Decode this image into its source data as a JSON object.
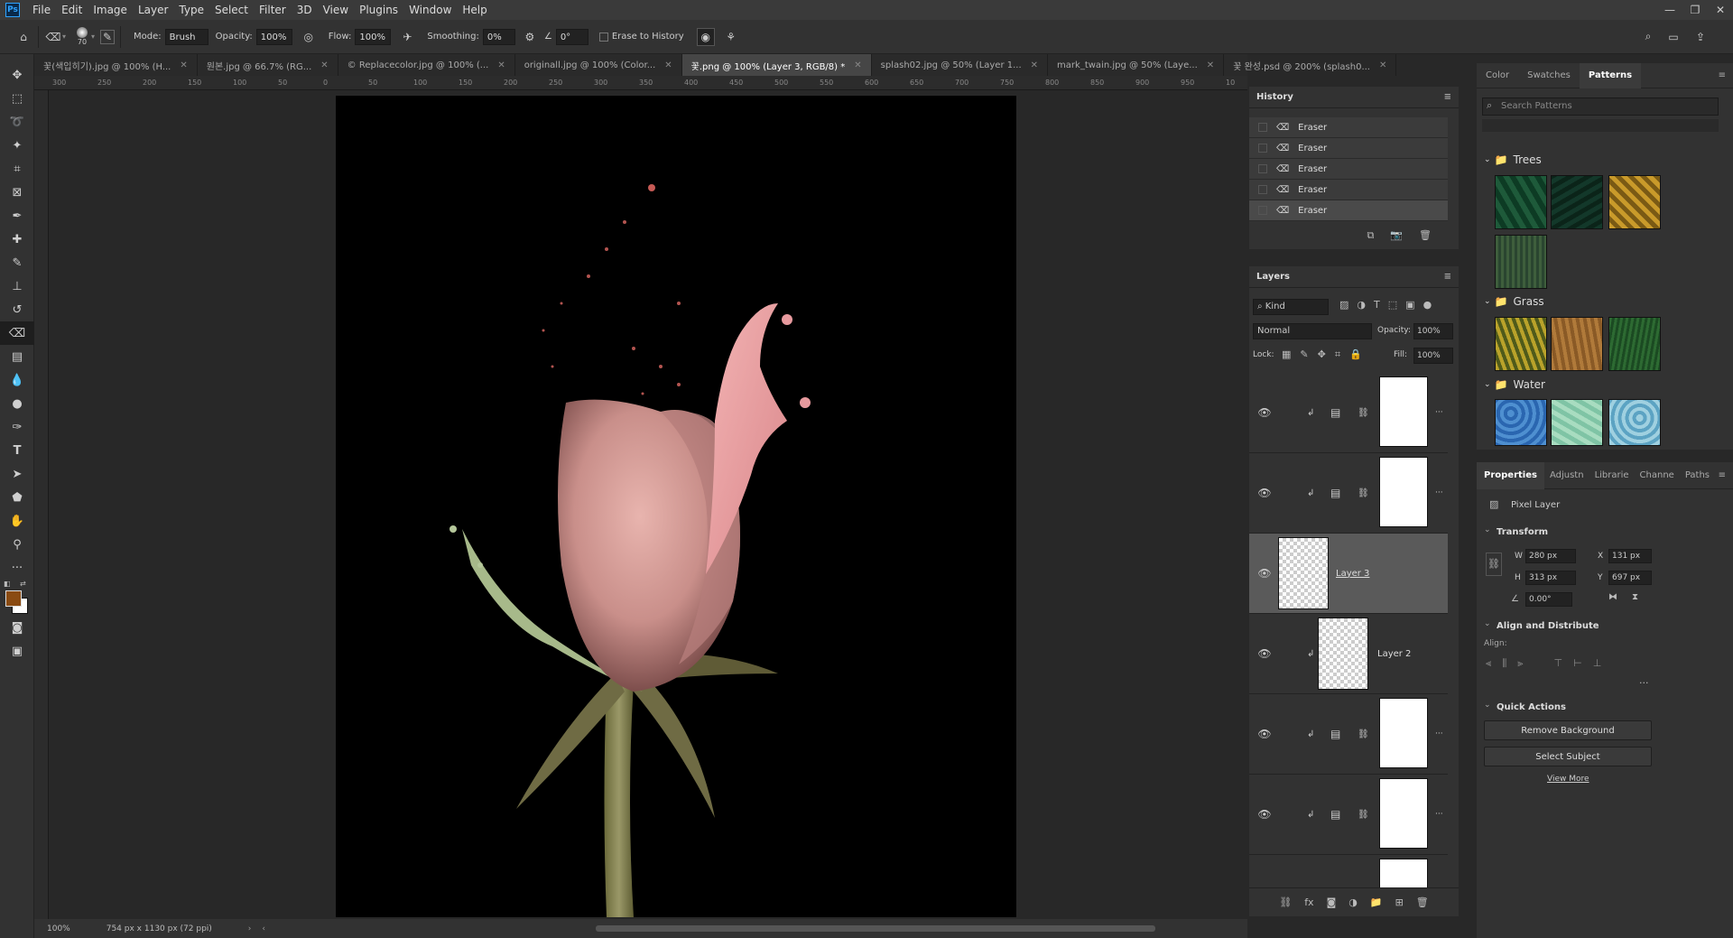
{
  "menu": {
    "logo": "Ps",
    "items": [
      "File",
      "Edit",
      "Image",
      "Layer",
      "Type",
      "Select",
      "Filter",
      "3D",
      "View",
      "Plugins",
      "Window",
      "Help"
    ]
  },
  "options": {
    "brush_size": "70",
    "mode_label": "Mode:",
    "mode_value": "Brush",
    "opacity_label": "Opacity:",
    "opacity_value": "100%",
    "flow_label": "Flow:",
    "flow_value": "100%",
    "smoothing_label": "Smoothing:",
    "smoothing_value": "0%",
    "angle_value": "0°",
    "erase_history_label": "Erase to History"
  },
  "tabs": [
    {
      "label": "꽃(색입히기).jpg @ 100% (H..."
    },
    {
      "label": "원본.jpg @ 66.7% (RG..."
    },
    {
      "label": "© Replacecolor.jpg @ 100% (..."
    },
    {
      "label": "originall.jpg @ 100% (Color..."
    },
    {
      "label": "꽃.png @ 100% (Layer 3, RGB/8) *"
    },
    {
      "label": "splash02.jpg @ 50% (Layer 1..."
    },
    {
      "label": "mark_twain.jpg @ 50% (Laye..."
    },
    {
      "label": "꽃 완성.psd @ 200% (splash0..."
    }
  ],
  "ruler_labels": [
    "300",
    "250",
    "200",
    "150",
    "100",
    "50",
    "0",
    "50",
    "100",
    "150",
    "200",
    "250",
    "300",
    "350",
    "400",
    "450",
    "500",
    "550",
    "600",
    "650",
    "700",
    "750",
    "800",
    "850",
    "900",
    "950",
    "10"
  ],
  "status": {
    "zoom": "100%",
    "doc_info": "754 px x 1130 px (72 ppi)"
  },
  "history": {
    "title": "History",
    "items": [
      "Eraser",
      "Eraser",
      "Eraser",
      "Eraser",
      "Eraser"
    ]
  },
  "layers": {
    "title": "Layers",
    "kind": "Kind",
    "blend_mode": "Normal",
    "opacity_label": "Opacity:",
    "opacity_value": "100%",
    "lock_label": "Lock:",
    "fill_label": "Fill:",
    "fill_value": "100%",
    "layer3_name": "Layer 3",
    "layer2_name": "Layer 2"
  },
  "patterns": {
    "tab_color": "Color",
    "tab_swatches": "Swatches",
    "tab_patterns": "Patterns",
    "search_placeholder": "Search Patterns",
    "groups": [
      "Trees",
      "Grass",
      "Water"
    ]
  },
  "properties": {
    "tabs": [
      "Properties",
      "Adjustn",
      "Librarie",
      "Channe",
      "Paths"
    ],
    "pixel_layer": "Pixel Layer",
    "transform": "Transform",
    "w_label": "W",
    "w_value": "280 px",
    "h_label": "H",
    "h_value": "313 px",
    "x_label": "X",
    "x_value": "131 px",
    "y_label": "Y",
    "y_value": "697 px",
    "angle_value": "0.00°",
    "align_title": "Align and Distribute",
    "align_label": "Align:",
    "quick_actions": "Quick Actions",
    "remove_bg": "Remove Background",
    "select_subject": "Select Subject",
    "view_more": "View More"
  },
  "colors": {
    "foreground": "#8a4b12",
    "background": "#ffffff",
    "panel": "#323232",
    "selected_layer": "#5a5a5a"
  }
}
